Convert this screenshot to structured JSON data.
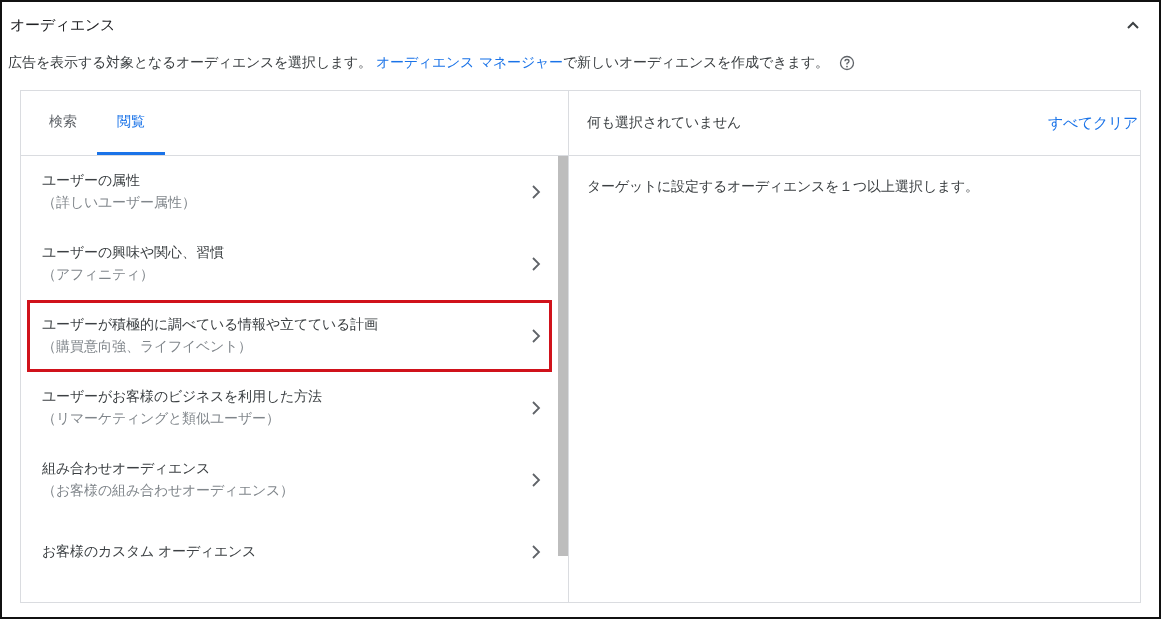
{
  "section": {
    "title": "オーディエンス",
    "expanded": true
  },
  "description": {
    "before": "広告を表示する対象となるオーディエンスを選択します。 ",
    "link": "オーディエンス マネージャー",
    "after": "で新しいオーディエンスを作成できます。"
  },
  "tabs": [
    {
      "label": "検索",
      "selected": false
    },
    {
      "label": "閲覧",
      "selected": true
    }
  ],
  "categories": [
    {
      "title": "ユーザーの属性",
      "subtitle": "（詳しいユーザー属性）",
      "highlighted": false
    },
    {
      "title": "ユーザーの興味や関心、習慣",
      "subtitle": "（アフィニティ）",
      "highlighted": false
    },
    {
      "title": "ユーザーが積極的に調べている情報や立てている計画",
      "subtitle": "（購買意向強、ライフイベント）",
      "highlighted": true
    },
    {
      "title": "ユーザーがお客様のビジネスを利用した方法",
      "subtitle": "（リマーケティングと類似ユーザー）",
      "highlighted": false
    },
    {
      "title": "組み合わせオーディエンス",
      "subtitle": "（お客様の組み合わせオーディエンス）",
      "highlighted": false
    },
    {
      "title": "お客様のカスタム オーディエンス",
      "highlighted": false
    }
  ],
  "selection": {
    "status": "何も選択されていません",
    "clear_all": "すべてクリア",
    "hint": "ターゲットに設定するオーディエンスを１つ以上選択します。"
  }
}
